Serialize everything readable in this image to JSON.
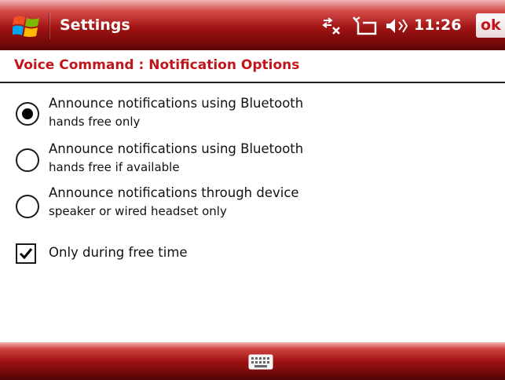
{
  "title_bar": {
    "app_title": "Settings",
    "time": "11:26",
    "ok_label": "ok",
    "icons": [
      "windows-start-icon",
      "connectivity-icon",
      "phone-signal-icon",
      "volume-icon"
    ]
  },
  "page": {
    "title": "Voice Command : Notification Options"
  },
  "options": [
    {
      "line1": "Announce notifications using Bluetooth",
      "line2": "hands free only",
      "selected": true
    },
    {
      "line1": "Announce notifications using Bluetooth",
      "line2": "hands free if available",
      "selected": false
    },
    {
      "line1": "Announce notifications through device",
      "line2": "speaker or wired headset only",
      "selected": false
    }
  ],
  "free_time": {
    "label": "Only during free time",
    "checked": true
  },
  "bottom_bar": {
    "icons": [
      "keyboard-icon"
    ]
  },
  "colors": {
    "accent": "#c0161b",
    "bar_dark": "#760909",
    "bar_light": "#d64a4a"
  }
}
